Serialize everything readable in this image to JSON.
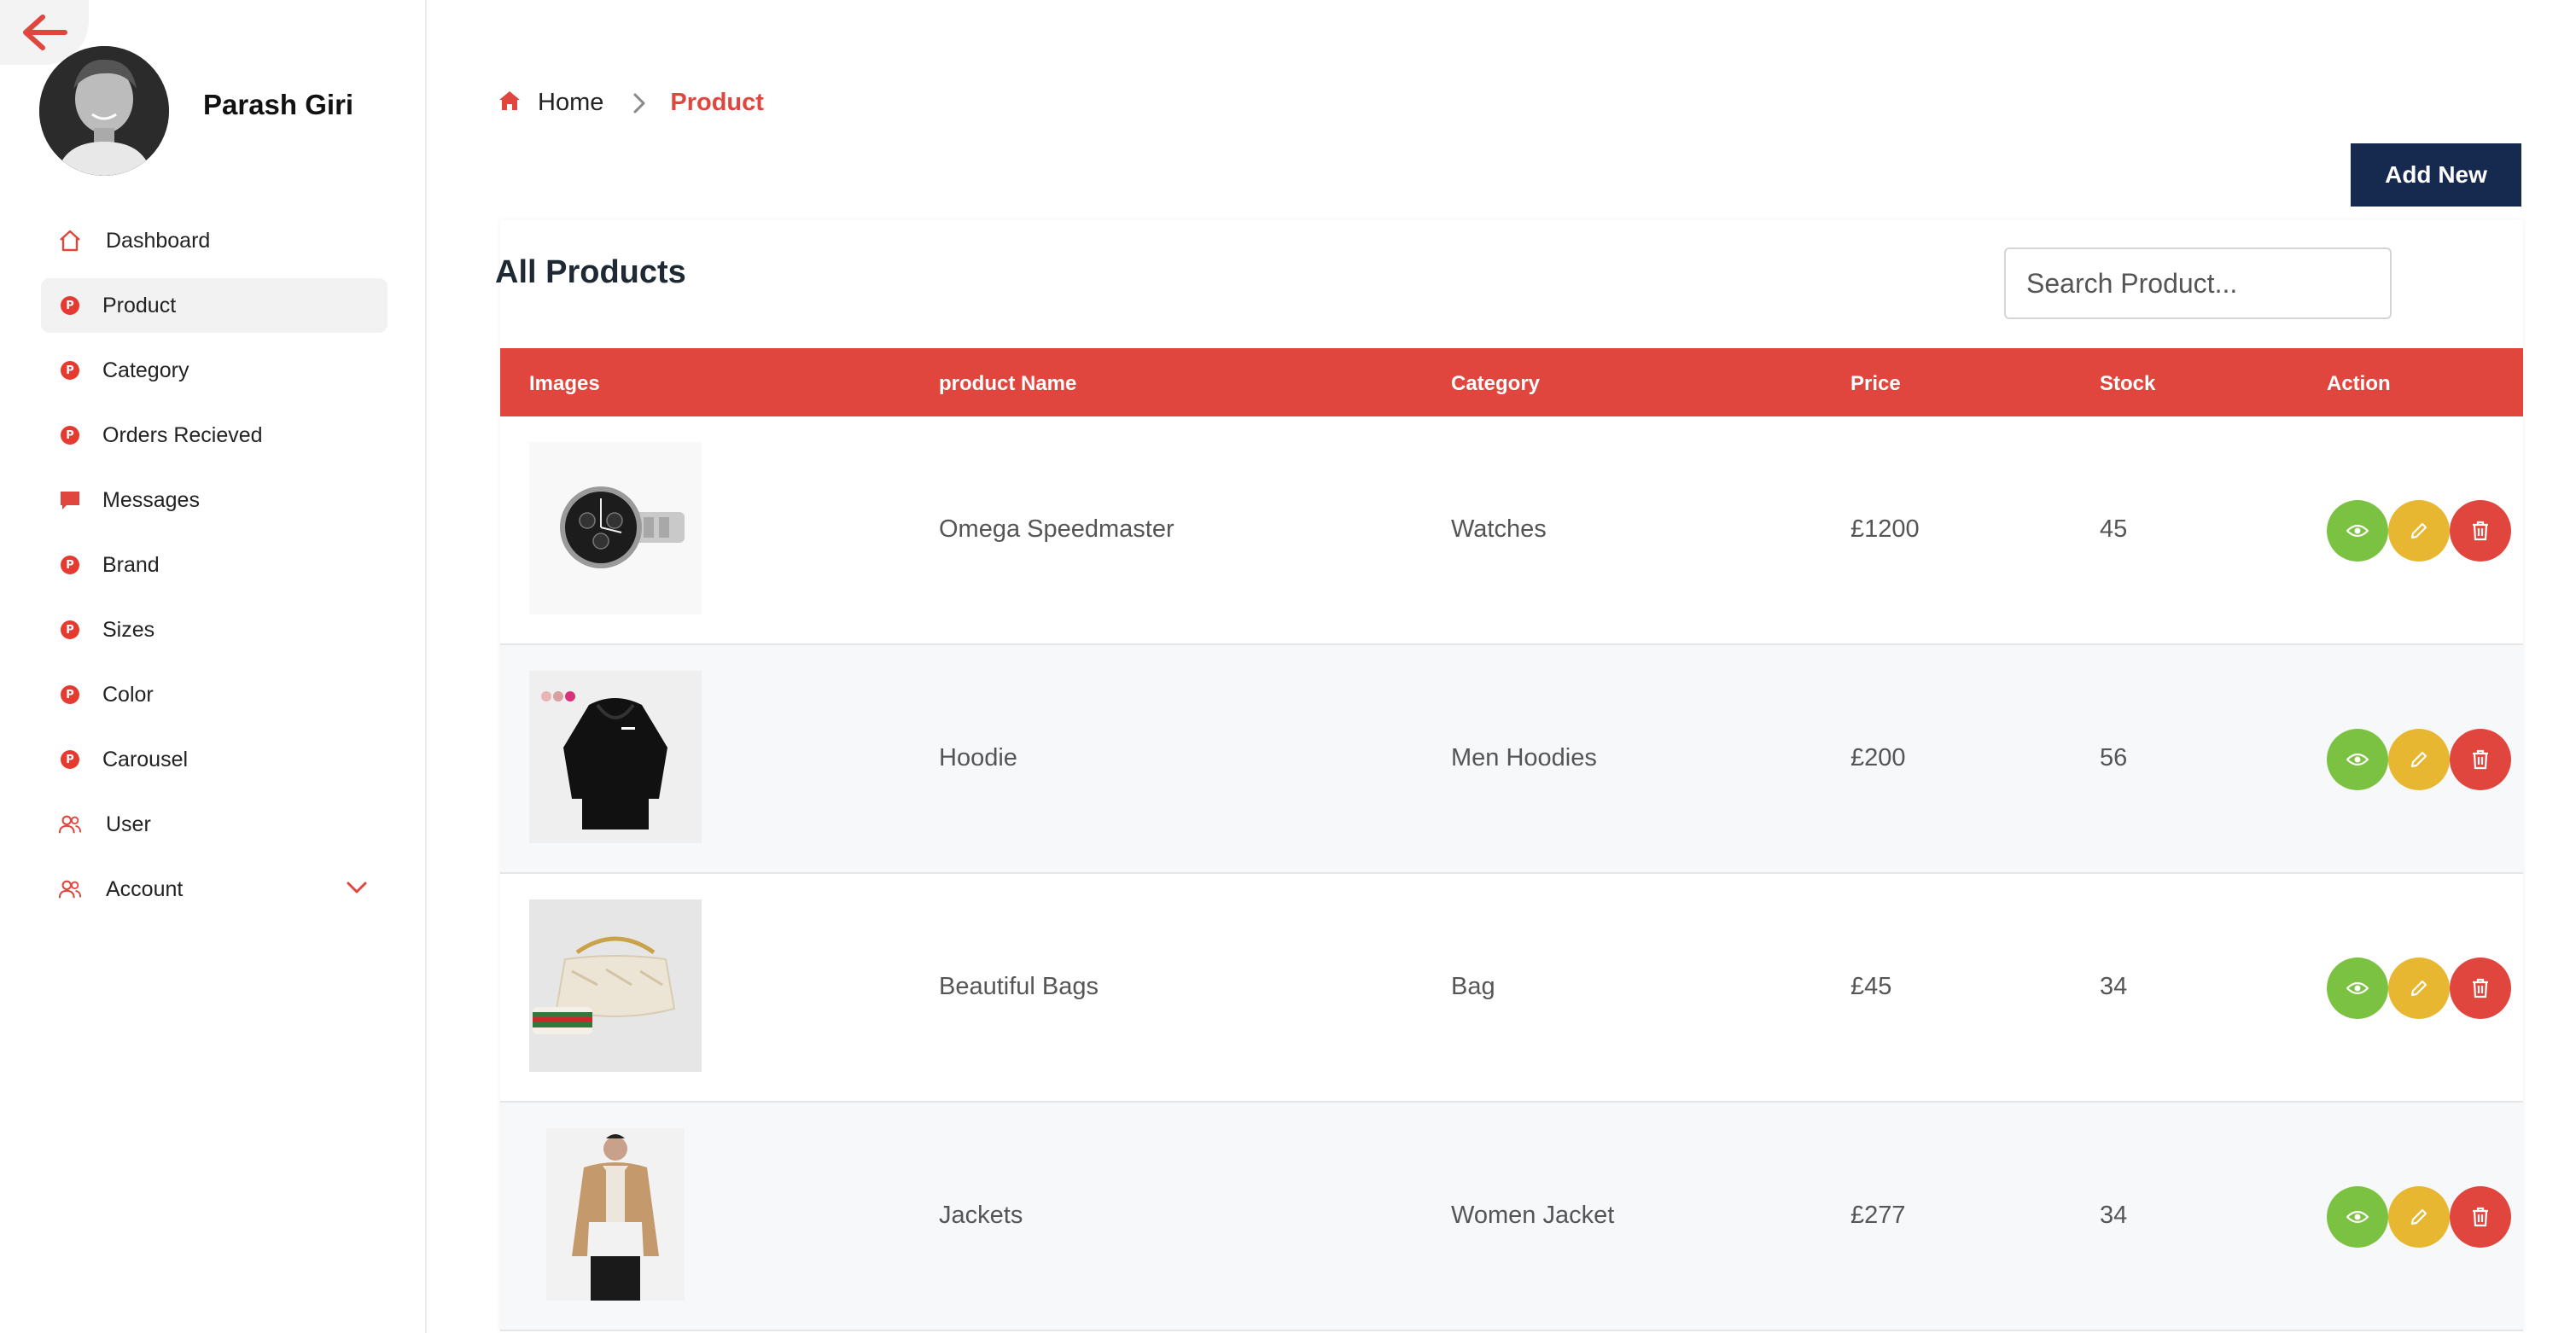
{
  "user": {
    "name": "Parash Giri"
  },
  "sidebar": {
    "items": [
      {
        "label": "Dashboard",
        "icon": "home-outline-icon"
      },
      {
        "label": "Product",
        "icon": "p-badge-icon",
        "active": true
      },
      {
        "label": "Category",
        "icon": "p-badge-icon"
      },
      {
        "label": "Orders Recieved",
        "icon": "p-badge-icon"
      },
      {
        "label": "Messages",
        "icon": "message-icon"
      },
      {
        "label": "Brand",
        "icon": "p-badge-icon"
      },
      {
        "label": "Sizes",
        "icon": "p-badge-icon"
      },
      {
        "label": "Color",
        "icon": "p-badge-icon"
      },
      {
        "label": "Carousel",
        "icon": "p-badge-icon"
      },
      {
        "label": "User",
        "icon": "users-icon"
      },
      {
        "label": "Account",
        "icon": "users-icon",
        "expandable": true
      }
    ]
  },
  "breadcrumb": {
    "home": "Home",
    "current": "Product"
  },
  "toolbar": {
    "add_label": "Add New"
  },
  "products": {
    "title": "All Products",
    "search_placeholder": "Search Product...",
    "columns": [
      "Images",
      "product Name",
      "Category",
      "Price",
      "Stock",
      "Action"
    ],
    "rows": [
      {
        "name": "Omega Speedmaster",
        "category": "Watches",
        "price": "£1200",
        "stock": "45",
        "image": "watch"
      },
      {
        "name": "Hoodie",
        "category": "Men Hoodies",
        "price": "£200",
        "stock": "56",
        "image": "hoodie"
      },
      {
        "name": "Beautiful Bags",
        "category": "Bag",
        "price": "£45",
        "stock": "34",
        "image": "bag"
      },
      {
        "name": "Jackets",
        "category": "Women Jacket",
        "price": "£277",
        "stock": "34",
        "image": "jacket"
      }
    ]
  },
  "colors": {
    "accent": "#e0463e",
    "navy": "#16294f",
    "view": "#7cc242",
    "edit": "#e7b731",
    "delete": "#e0463e"
  }
}
